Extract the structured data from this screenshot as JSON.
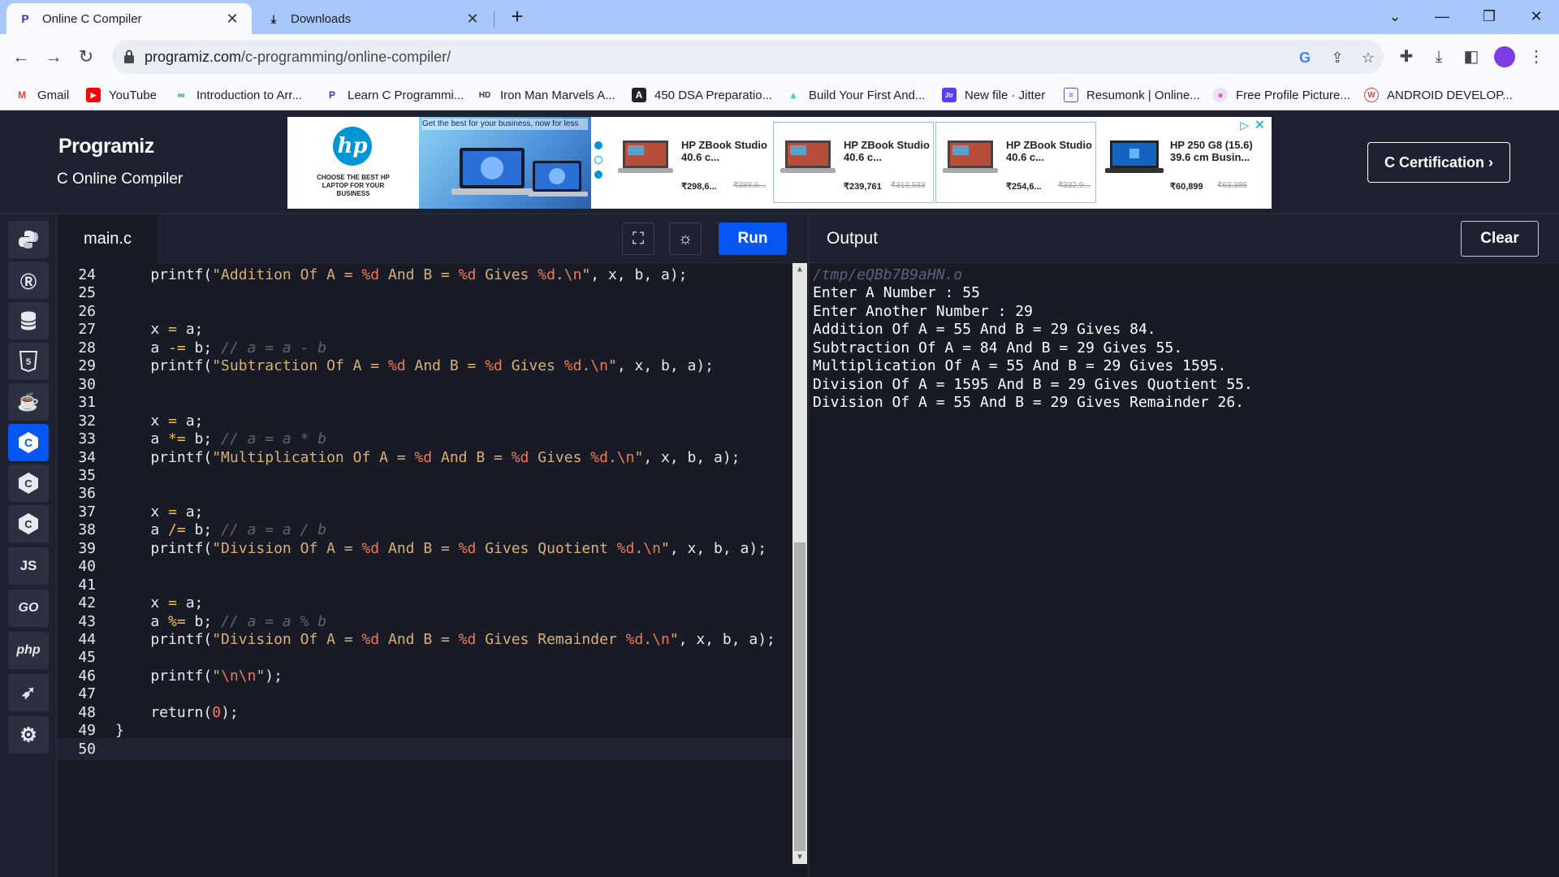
{
  "browser": {
    "tabs": [
      {
        "title": "Online C Compiler",
        "icon": "programiz-favicon"
      },
      {
        "title": "Downloads",
        "icon": "download-icon"
      }
    ],
    "url_host": "programiz.com",
    "url_path": "/c-programming/online-compiler/",
    "bookmarks": [
      {
        "label": "Gmail",
        "icon": "gmail-icon"
      },
      {
        "label": "YouTube",
        "icon": "youtube-icon"
      },
      {
        "label": "Introduction to Arr...",
        "icon": "gfg-icon"
      },
      {
        "label": "Learn C Programmi...",
        "icon": "programiz-favicon"
      },
      {
        "label": "Iron Man Marvels A...",
        "icon": "hd-icon"
      },
      {
        "label": "450 DSA Preparatio...",
        "icon": "angular-icon"
      },
      {
        "label": "Build Your First And...",
        "icon": "android-icon"
      },
      {
        "label": "New file · Jitter",
        "icon": "jitter-icon"
      },
      {
        "label": "Resumonk | Online...",
        "icon": "resumonk-icon"
      },
      {
        "label": "Free Profile Picture...",
        "icon": "profile-pic-icon"
      },
      {
        "label": "ANDROID DEVELOP...",
        "icon": "android-dev-icon"
      }
    ]
  },
  "header": {
    "logo": "Programiz",
    "subtitle": "C Online Compiler",
    "cert_button": "C Certification ›"
  },
  "ad": {
    "brand": "hp",
    "tagline": "CHOOSE THE BEST HP LAPTOP FOR YOUR BUSINESS",
    "banner_text": "Get the best for your business, now for less",
    "products": [
      {
        "name": "HP ZBook Studio 40.6 c...",
        "price": "₹298,6...",
        "old": "₹388,6..."
      },
      {
        "name": "HP ZBook Studio 40.6 c...",
        "price": "₹239,761",
        "old": "₹313,533"
      },
      {
        "name": "HP ZBook Studio 40.6 c...",
        "price": "₹254,6...",
        "old": "₹332,9..."
      },
      {
        "name": "HP 250 G8 (15.6) 39.6 cm Busin...",
        "price": "₹60,899",
        "old": "₹63,386"
      }
    ]
  },
  "languages": [
    "python-icon",
    "r-icon",
    "sql-icon",
    "html5-icon",
    "java-icon",
    "c-icon",
    "cpp-icon",
    "csharp-icon",
    "JS",
    "GO",
    "php",
    "swift-icon",
    "rust-icon"
  ],
  "editor": {
    "file_tab": "main.c",
    "run_label": "Run",
    "lines": [
      {
        "n": "24",
        "code": "    printf(\"Addition Of A = %d And B = %d Gives %d.\\n\", x, b, a);"
      },
      {
        "n": "25",
        "code": ""
      },
      {
        "n": "26",
        "code": ""
      },
      {
        "n": "27",
        "code": "    x = a;"
      },
      {
        "n": "28",
        "code": "    a -= b; // a = a - b"
      },
      {
        "n": "29",
        "code": "    printf(\"Subtraction Of A = %d And B = %d Gives %d.\\n\", x, b, a);"
      },
      {
        "n": "30",
        "code": ""
      },
      {
        "n": "31",
        "code": ""
      },
      {
        "n": "32",
        "code": "    x = a;"
      },
      {
        "n": "33",
        "code": "    a *= b; // a = a * b"
      },
      {
        "n": "34",
        "code": "    printf(\"Multiplication Of A = %d And B = %d Gives %d.\\n\", x, b, a);"
      },
      {
        "n": "35",
        "code": ""
      },
      {
        "n": "36",
        "code": ""
      },
      {
        "n": "37",
        "code": "    x = a;"
      },
      {
        "n": "38",
        "code": "    a /= b; // a = a / b"
      },
      {
        "n": "39",
        "code": "    printf(\"Division Of A = %d And B = %d Gives Quotient %d.\\n\", x, b, a);"
      },
      {
        "n": "40",
        "code": ""
      },
      {
        "n": "41",
        "code": ""
      },
      {
        "n": "42",
        "code": "    x = a;"
      },
      {
        "n": "43",
        "code": "    a %= b; // a = a % b"
      },
      {
        "n": "44",
        "code": "    printf(\"Division Of A = %d And B = %d Gives Remainder %d.\\n\", x, b, a);"
      },
      {
        "n": "45",
        "code": ""
      },
      {
        "n": "46",
        "code": "    printf(\"\\n\\n\");"
      },
      {
        "n": "47",
        "code": ""
      },
      {
        "n": "48",
        "code": "    return(0);"
      },
      {
        "n": "49",
        "code": "}"
      },
      {
        "n": "50",
        "code": ""
      }
    ]
  },
  "output": {
    "label": "Output",
    "clear_label": "Clear",
    "lines": [
      "/tmp/eQBb7B9aHN.o",
      "Enter A Number : 55",
      "Enter Another Number : 29",
      "Addition Of A = 55 And B = 29 Gives 84.",
      "Subtraction Of A = 84 And B = 29 Gives 55.",
      "Multiplication Of A = 55 And B = 29 Gives 1595.",
      "Division Of A = 1595 And B = 29 Gives Quotient 55.",
      "Division Of A = 55 And B = 29 Gives Remainder 26."
    ]
  },
  "colors": {
    "accent": "#0556f3",
    "page_bg": "#1e2230",
    "editor_bg": "#181b26",
    "string": "#d8b074",
    "format_spec": "#f07858",
    "comment": "#5c6375"
  }
}
